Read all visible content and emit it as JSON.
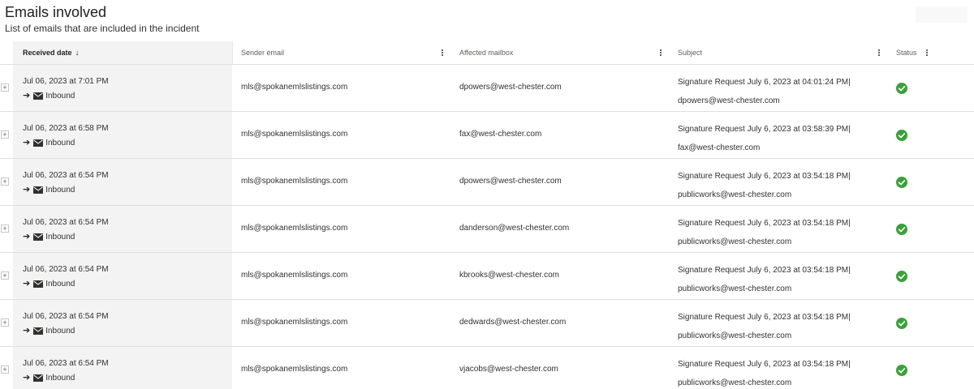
{
  "header": {
    "title": "Emails involved",
    "subtitle": "List of emails that are included in the incident"
  },
  "columns": {
    "received_date": "Received date",
    "sort_indicator": "↓",
    "sender_email": "Sender email",
    "affected_mailbox": "Affected mailbox",
    "subject": "Subject",
    "status": "Status"
  },
  "rows": [
    {
      "date": "Jul 06, 2023 at 7:01 PM",
      "direction": "Inbound",
      "sender": "mls@spokanemlslistings.com",
      "mailbox": "dpowers@west-chester.com",
      "subject": "Signature Request July 6, 2023 at 04:01:24 PM| dpowers@west-chester.com",
      "status_icon": "check-circle-icon"
    },
    {
      "date": "Jul 06, 2023 at 6:58 PM",
      "direction": "Inbound",
      "sender": "mls@spokanemlslistings.com",
      "mailbox": "fax@west-chester.com",
      "subject": "Signature Request July 6, 2023 at 03:58:39 PM| fax@west-chester.com",
      "status_icon": "check-circle-icon"
    },
    {
      "date": "Jul 06, 2023 at 6:54 PM",
      "direction": "Inbound",
      "sender": "mls@spokanemlslistings.com",
      "mailbox": "dpowers@west-chester.com",
      "subject": "Signature Request July 6, 2023 at 03:54:18 PM| publicworks@west-chester.com",
      "status_icon": "check-circle-icon"
    },
    {
      "date": "Jul 06, 2023 at 6:54 PM",
      "direction": "Inbound",
      "sender": "mls@spokanemlslistings.com",
      "mailbox": "danderson@west-chester.com",
      "subject": "Signature Request July 6, 2023 at 03:54:18 PM| publicworks@west-chester.com",
      "status_icon": "check-circle-icon"
    },
    {
      "date": "Jul 06, 2023 at 6:54 PM",
      "direction": "Inbound",
      "sender": "mls@spokanemlslistings.com",
      "mailbox": "kbrooks@west-chester.com",
      "subject": "Signature Request July 6, 2023 at 03:54:18 PM| publicworks@west-chester.com",
      "status_icon": "check-circle-icon"
    },
    {
      "date": "Jul 06, 2023 at 6:54 PM",
      "direction": "Inbound",
      "sender": "mls@spokanemlslistings.com",
      "mailbox": "dedwards@west-chester.com",
      "subject": "Signature Request July 6, 2023 at 03:54:18 PM| publicworks@west-chester.com",
      "status_icon": "check-circle-icon"
    },
    {
      "date": "Jul 06, 2023 at 6:54 PM",
      "direction": "Inbound",
      "sender": "mls@spokanemlslistings.com",
      "mailbox": "vjacobs@west-chester.com",
      "subject": "Signature Request July 6, 2023 at 03:54:18 PM| publicworks@west-chester.com",
      "status_icon": "check-circle-icon"
    }
  ],
  "colors": {
    "status_ok": "#3aa13a",
    "sorted_column_bg": "#f3f3f3",
    "row_border": "#e1dfdd"
  }
}
